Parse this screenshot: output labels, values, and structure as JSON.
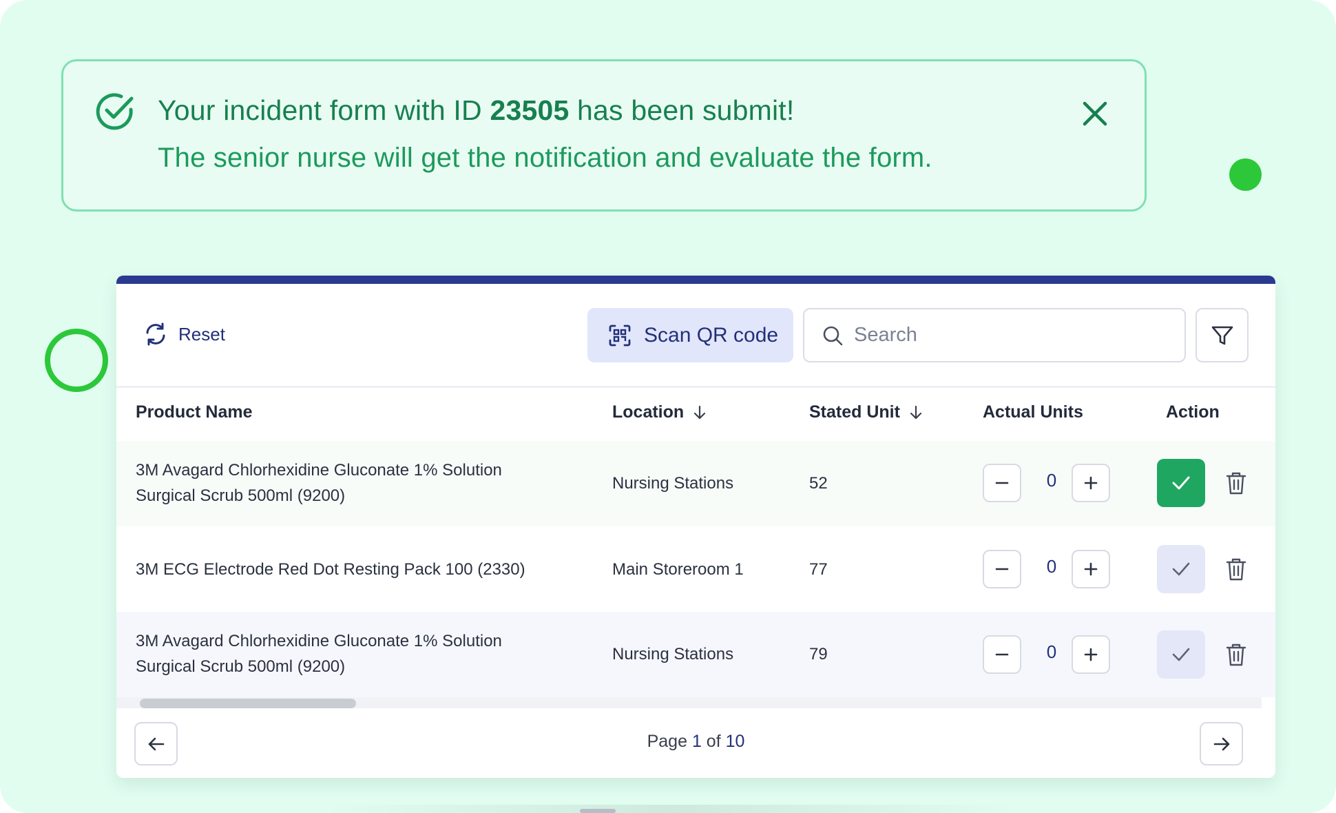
{
  "toast": {
    "title_prefix": "Your incident form with ID ",
    "form_id": "23505",
    "title_suffix": " has been submit!",
    "message": "The senior nurse will get the notification and evaluate the form.",
    "close_icon": "close-icon",
    "status_icon": "check-circle-icon"
  },
  "toolbar": {
    "reset_label": "Reset",
    "scan_label": "Scan QR code",
    "search_placeholder": "Search",
    "filter_icon": "filter-icon"
  },
  "table": {
    "headers": {
      "product": "Product Name",
      "location": "Location",
      "stated_unit": "Stated Unit",
      "actual_units": "Actual Units",
      "action": "Action"
    },
    "rows": [
      {
        "name": "3M Avagard Chlorhexidine Gluconate 1% Solution Surgical Scrub 500ml (9200)",
        "location": "Nursing Stations",
        "stated_unit": "52",
        "actual": "0",
        "confirmed": true
      },
      {
        "name": "3M ECG Electrode Red Dot Resting Pack 100 (2330)",
        "location": "Main Storeroom 1",
        "stated_unit": "77",
        "actual": "0",
        "confirmed": false
      },
      {
        "name": "3M Avagard Chlorhexidine Gluconate 1% Solution Surgical Scrub 500ml (9200)",
        "location": "Nursing Stations",
        "stated_unit": "79",
        "actual": "0",
        "confirmed": false
      }
    ]
  },
  "pagination": {
    "page_label": "Page ",
    "current": "1",
    "of_label": " of ",
    "total": "10"
  },
  "colors": {
    "success": "#1fa761",
    "brand": "#22307a",
    "toast_bg": "#e9fcf3",
    "accent_dot": "#2cc83a"
  }
}
